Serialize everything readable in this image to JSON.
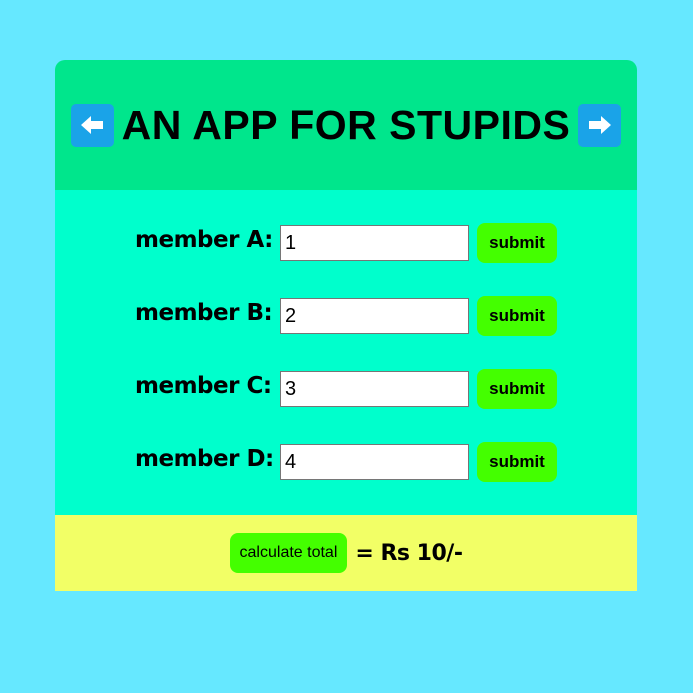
{
  "header": {
    "title": "AN APP FOR STUPIDS",
    "left_arrow_icon": "arrow-left-icon",
    "right_arrow_icon": "arrow-right-icon"
  },
  "members": [
    {
      "label": "member A:",
      "value": "1",
      "submit_label": "submit"
    },
    {
      "label": "member B:",
      "value": "2",
      "submit_label": "submit"
    },
    {
      "label": "member C:",
      "value": "3",
      "submit_label": "submit"
    },
    {
      "label": "member D:",
      "value": "4",
      "submit_label": "submit"
    }
  ],
  "footer": {
    "calculate_label": "calculate total",
    "total_text": "= Rs 10/-"
  },
  "colors": {
    "page_background": "#66e8ff",
    "header_background": "#00e68c",
    "members_background": "#00ffcc",
    "footer_background": "#f2ff66",
    "button_green": "#44ff00",
    "arrow_button_blue": "#1aa3e8"
  }
}
